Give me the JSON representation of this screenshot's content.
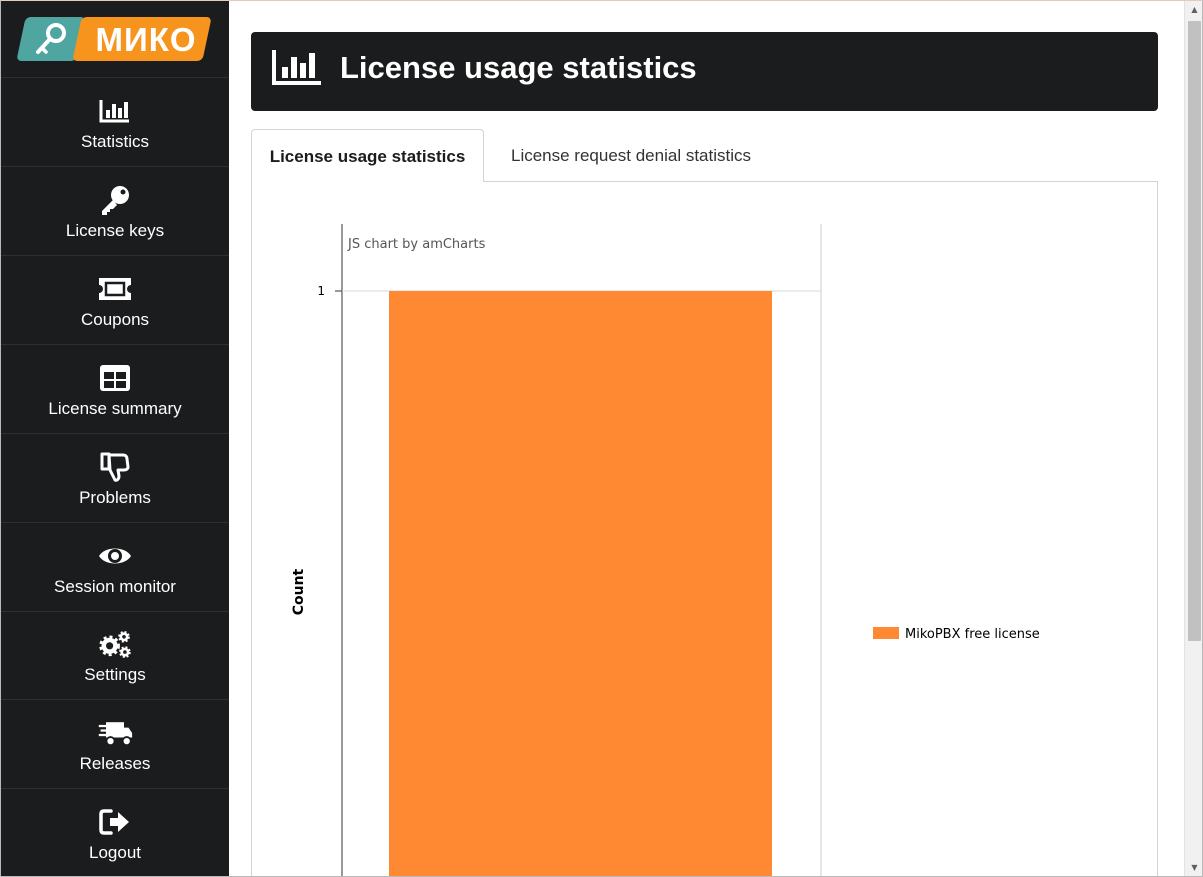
{
  "brand": {
    "logo_text": "МИКО"
  },
  "sidebar": {
    "items": [
      {
        "label": "Statistics",
        "icon": "bar-chart-icon"
      },
      {
        "label": "License keys",
        "icon": "key-icon"
      },
      {
        "label": "Coupons",
        "icon": "ticket-icon"
      },
      {
        "label": "License summary",
        "icon": "table-icon"
      },
      {
        "label": "Problems",
        "icon": "thumbs-down-icon"
      },
      {
        "label": "Session monitor",
        "icon": "eye-icon"
      },
      {
        "label": "Settings",
        "icon": "gears-icon"
      },
      {
        "label": "Releases",
        "icon": "shipping-truck-icon"
      },
      {
        "label": "Logout",
        "icon": "sign-out-icon"
      }
    ]
  },
  "header": {
    "title": "License usage statistics",
    "icon": "bar-chart-icon"
  },
  "tabs": [
    {
      "label": "License usage statistics",
      "active": true
    },
    {
      "label": "License request denial statistics",
      "active": false
    }
  ],
  "colors": {
    "sidebar_bg": "#1b1c1d",
    "accent_orange": "#ff8833",
    "logo_teal": "#4fa5a0",
    "logo_orange": "#f7941d"
  },
  "chart_data": {
    "type": "bar",
    "watermark": "JS chart by amCharts",
    "ylabel": "Count",
    "y_ticks": [
      "1"
    ],
    "ylim": [
      0,
      1
    ],
    "categories": [
      ""
    ],
    "series": [
      {
        "name": "MikoPBX free license",
        "values": [
          1
        ],
        "color": "#ff8833"
      }
    ],
    "legend_position": "right",
    "grid": true
  }
}
